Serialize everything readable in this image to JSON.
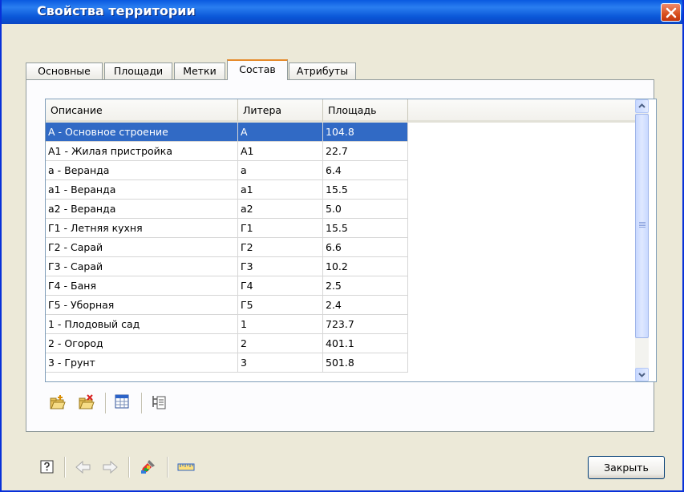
{
  "window": {
    "title": "Свойства территории"
  },
  "tabs": [
    {
      "label": "Основные",
      "active": false
    },
    {
      "label": "Площади",
      "active": false
    },
    {
      "label": "Метки",
      "active": false
    },
    {
      "label": "Состав",
      "active": true
    },
    {
      "label": "Атрибуты",
      "active": false
    }
  ],
  "table": {
    "columns": [
      "Описание",
      "Литера",
      "Площадь"
    ],
    "selected_row": 0,
    "rows": [
      [
        "А - Основное строение",
        "А",
        "104.8"
      ],
      [
        "А1 - Жилая пристройка",
        "А1",
        "22.7"
      ],
      [
        "а - Веранда",
        "а",
        "6.4"
      ],
      [
        "а1 - Веранда",
        "а1",
        "15.5"
      ],
      [
        "а2 - Веранда",
        "а2",
        "5.0"
      ],
      [
        "Г1 - Летняя кухня",
        "Г1",
        "15.5"
      ],
      [
        "Г2 - Сарай",
        "Г2",
        "6.6"
      ],
      [
        "Г3 - Сарай",
        "Г3",
        "10.2"
      ],
      [
        "Г4 - Баня",
        "Г4",
        "2.5"
      ],
      [
        "Г5 - Уборная",
        "Г5",
        "2.4"
      ],
      [
        "1 - Плодовый сад",
        "1",
        "723.7"
      ],
      [
        "2 - Огород",
        "2",
        "401.1"
      ],
      [
        "3 - Грунт",
        "3",
        "501.8"
      ]
    ]
  },
  "toolbar_icons": [
    "add-folder-icon",
    "delete-folder-icon",
    "table-icon",
    "tree-filter-icon"
  ],
  "bottom_icons": [
    "help-icon",
    "back-arrow-icon",
    "forward-arrow-icon",
    "paint-brush-icon",
    "ruler-icon"
  ],
  "buttons": {
    "close_label": "Закрыть"
  },
  "colors": {
    "titlebar": "#0a5ae0",
    "selection": "#316ac5",
    "active_tab_accent": "#e68b2c",
    "dialog_bg": "#ece9d8"
  }
}
